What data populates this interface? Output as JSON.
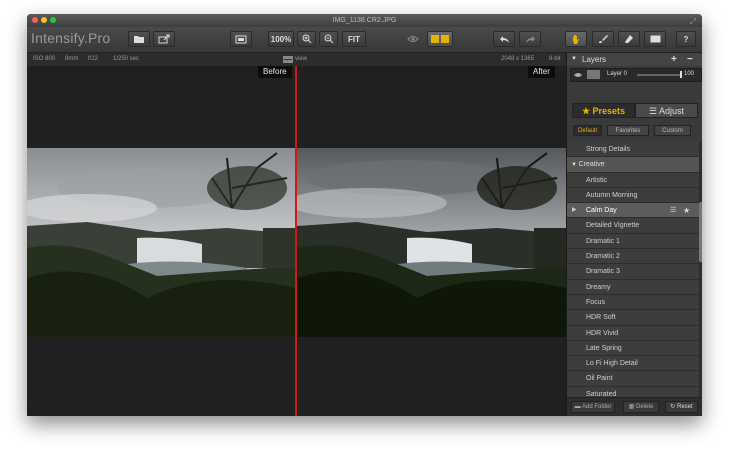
{
  "window": {
    "title": "IMG_1138.CR2.JPG",
    "icons": [
      "close",
      "minimize",
      "zoom",
      "fullscreen-icon"
    ]
  },
  "toolbar": {
    "logo": "Intensify.Pro",
    "zoom_100": "100%",
    "fit": "FIT",
    "help": "?",
    "icons": [
      "folder-icon",
      "share-icon",
      "compare-view-icon",
      "zoom-in-icon",
      "zoom-out-icon",
      "eye-icon",
      "split-view-icon",
      "undo-icon",
      "redo-icon",
      "hand-icon",
      "brush-icon",
      "eraser-icon",
      "mask-icon"
    ]
  },
  "infobar": {
    "iso": "ISO 800",
    "focal": "8mm",
    "aperture": "f/22",
    "shutter": "1/250 sec",
    "view_label": "view",
    "size": "2048 x 1365",
    "bit": "8-bit"
  },
  "canvas": {
    "before": "Before",
    "after": "After"
  },
  "layers": {
    "title": "Layers",
    "layer_name": "Layer 0",
    "opacity": "100",
    "opacity_fraction": 1.0
  },
  "tabs": {
    "presets": "Presets",
    "adjust": "Adjust",
    "active": "presets"
  },
  "filters": {
    "default": "Default",
    "favorites": "Favorites",
    "custom": "Custom",
    "active": "default"
  },
  "presets": {
    "items": [
      {
        "label": "Strong Details",
        "type": "item"
      },
      {
        "label": "Creative",
        "type": "group"
      },
      {
        "label": "Artistic",
        "type": "item"
      },
      {
        "label": "Autumn Morning",
        "type": "item"
      },
      {
        "label": "Calm Day",
        "type": "selected"
      },
      {
        "label": "Detailed Vignette",
        "type": "item"
      },
      {
        "label": "Dramatic 1",
        "type": "item"
      },
      {
        "label": "Dramatic 2",
        "type": "item"
      },
      {
        "label": "Dramatic 3",
        "type": "item"
      },
      {
        "label": "Dreamy",
        "type": "item"
      },
      {
        "label": "Focus",
        "type": "item"
      },
      {
        "label": "HDR Soft",
        "type": "item"
      },
      {
        "label": "HDR Vivid",
        "type": "item"
      },
      {
        "label": "Late Spring",
        "type": "item"
      },
      {
        "label": "Lo Fi High Detail",
        "type": "item"
      },
      {
        "label": "Oil Paint",
        "type": "item"
      },
      {
        "label": "Saturated",
        "type": "item"
      }
    ]
  },
  "footer": {
    "add_folder": "Add Folder",
    "delete": "Delete",
    "reset": "Reset"
  },
  "colors": {
    "accent": "#e6b400",
    "divider": "#d01818",
    "panel": "#3a3a3a"
  }
}
